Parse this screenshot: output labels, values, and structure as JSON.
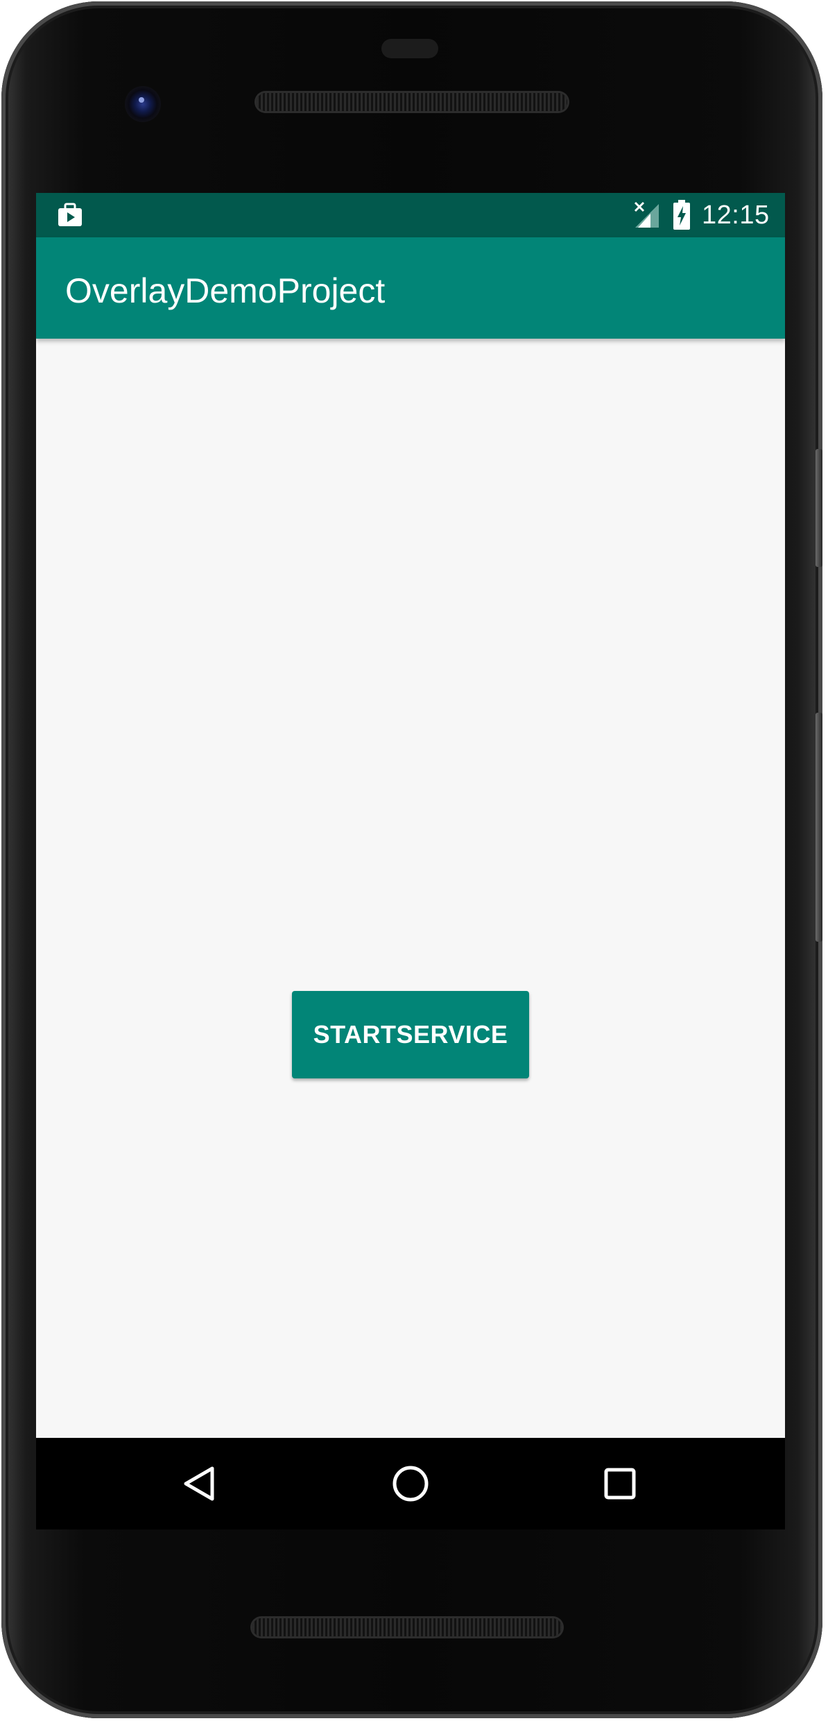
{
  "status_bar": {
    "time": "12:15",
    "left_icon": "work-briefcase-icon",
    "signal_icon": "no-signal-icon",
    "battery_icon": "battery-charging-icon"
  },
  "app_bar": {
    "title": "OverlayDemoProject"
  },
  "main": {
    "start_button_label": "STARTSERVICE"
  },
  "nav_bar": {
    "back_icon": "back-triangle-icon",
    "home_icon": "home-circle-icon",
    "recents_icon": "recents-square-icon"
  },
  "colors": {
    "primary": "#028577",
    "primary_dark": "#02594d",
    "background": "#f7f7f7",
    "text_on_primary": "#ffffff"
  }
}
